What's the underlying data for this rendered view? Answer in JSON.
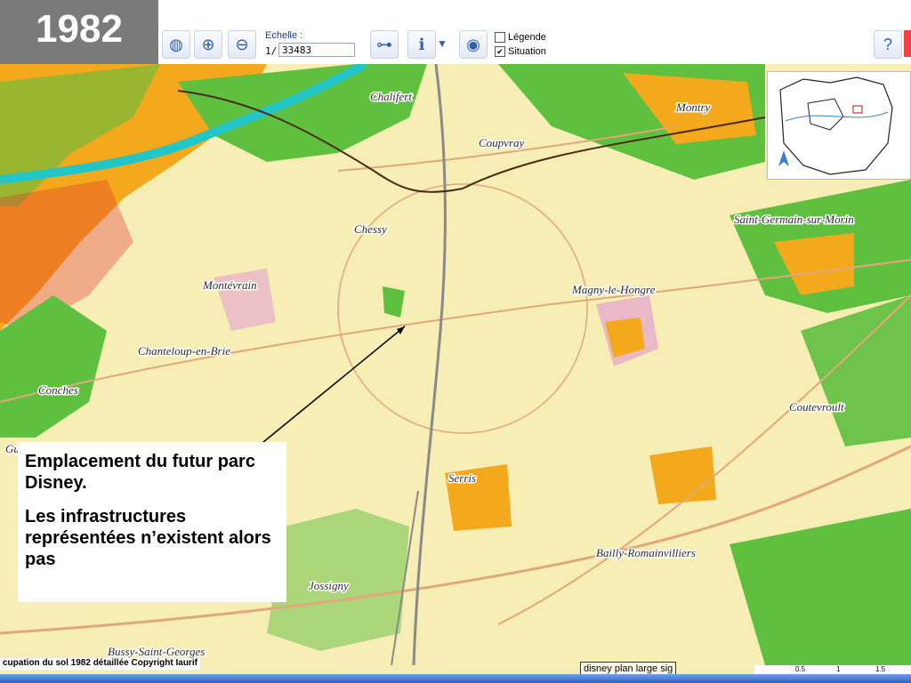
{
  "year": "1982",
  "toolbar": {
    "scale_label": "Echelle :",
    "scale_prefix": "1/",
    "scale_value": "33483",
    "legend_label": "Légende",
    "legend_checked": false,
    "situation_label": "Situation",
    "situation_checked": true,
    "icons": [
      "globe-icon",
      "zoom-in-icon",
      "zoom-out-icon",
      "binoculars-icon",
      "info-icon",
      "dropdown-arrow-icon",
      "globe-add-icon",
      "help-icon"
    ]
  },
  "places": {
    "chalifert": "Chalifert",
    "montry": "Montry",
    "coupvray": "Coupvray",
    "chessy": "Chessy",
    "saint_germain": "Saint-Germain-sur-Morin",
    "montevrain": "Montévrain",
    "magny": "Magny-le-Hongre",
    "chanteloup": "Chanteloup-en-Brie",
    "conches": "Conches",
    "coutevroult": "Coutevroult",
    "serris": "Serris",
    "bailly": "Bailly-Romainvilliers",
    "jossigny": "Jossigny",
    "bussy": "Bussy-Saint-Georges",
    "gu": "Gu"
  },
  "callout": {
    "line1": "Emplacement du futur parc Disney.",
    "line2": "Les infrastructures représentées n’existent alors pas"
  },
  "copyright": "cupation du sol 1982 détaillée Copyright Iaurif",
  "tooltip": "disney plan large sig",
  "scalebar": {
    "ticks": [
      "0.5",
      "1",
      "1.5"
    ]
  },
  "colors": {
    "urban": "#f3a91b",
    "green": "#5fbf3f",
    "bright_green": "#2fe82f",
    "river": "#22c6c6",
    "road": "#e2a77a",
    "rail": "#8a8a8a",
    "residential": "#e6a3d0",
    "industrial": "#8b33b5",
    "red": "#e23030"
  }
}
